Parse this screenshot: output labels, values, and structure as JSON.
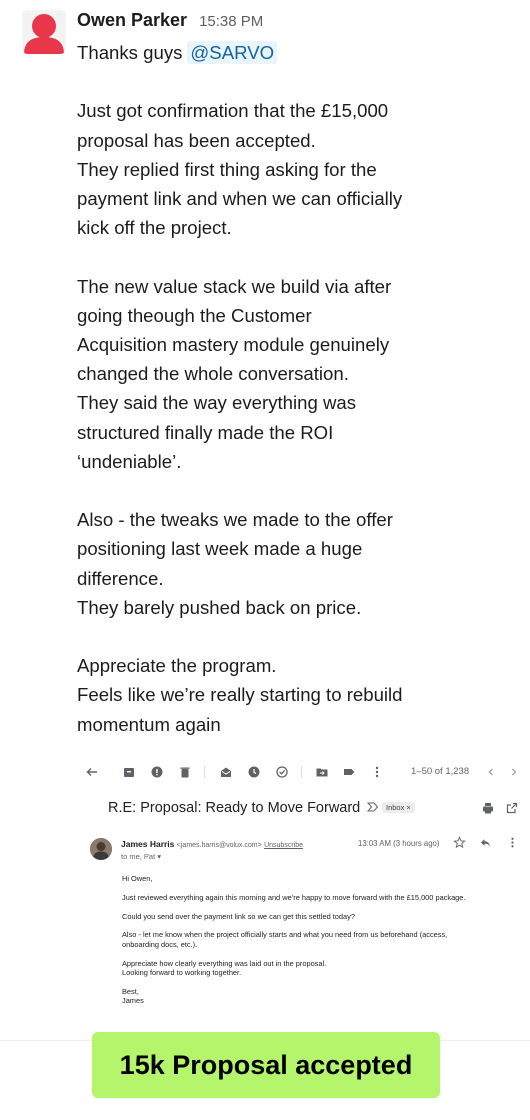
{
  "message": {
    "author": "Owen Parker",
    "time": "15:38 PM",
    "first_line": "Thanks guys",
    "mention": "@SARVO",
    "lines": [
      "",
      "Just got confirmation that the £15,000",
      "proposal has been accepted.",
      "They replied first thing asking for the",
      "payment link and when we can officially",
      "kick off the project.",
      "",
      "The new value stack we build via after",
      "going theough the Customer",
      "Acquisition mastery module  genuinely",
      "changed the whole conversation.",
      "They said the way everything was",
      "structured finally made the ROI",
      "‘undeniable’.",
      "",
      "Also - the tweaks we made to the offer",
      "positioning last week made a huge",
      "difference.",
      "They barely pushed back on price.",
      "",
      "Appreciate the program.",
      "Feels like we’re really starting to rebuild",
      "momentum again"
    ]
  },
  "email": {
    "pager": "1–50 of 1,238",
    "subject": "R.E: Proposal: Ready to Move Forward",
    "label": "Inbox ×",
    "sender_name": "James Harris",
    "sender_email": "<james.harris@volux.com>",
    "unsubscribe": "Unsubscribe",
    "to": "to me, Pat ▾",
    "date": "13:03 AM (3 hours ago)",
    "body": [
      [
        "Hi Owen,"
      ],
      [
        "Just reviewed everything again this morning and we’re happy to move forward with the £15,000 package."
      ],
      [
        "Could you send over the payment link so we can get this settled today?"
      ],
      [
        "Also - let me know when the project officially starts and what you need from us beforehand (access,",
        "onboarding docs, etc.)."
      ],
      [
        "Appreciate how clearly everything was laid out in the proposal.",
        "Looking forward to working together."
      ],
      [
        "Best,",
        "James"
      ]
    ]
  },
  "banner": {
    "text": "15k Proposal accepted"
  },
  "colors": {
    "banner_bg": "#b5f56b",
    "avatar_red": "#e8364a",
    "mention": "#1264a3"
  }
}
